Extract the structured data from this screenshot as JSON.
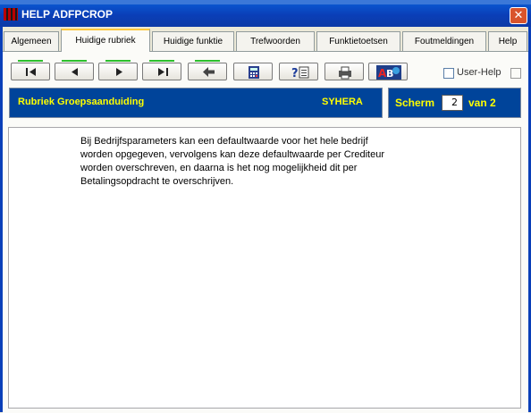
{
  "window": {
    "title": "HELP ADFPCROP",
    "close_glyph": "✕"
  },
  "tabs": [
    {
      "label": "Algemeen",
      "active": false
    },
    {
      "label": "Huidige rubriek",
      "active": true
    },
    {
      "label": "Huidige funktie",
      "active": false
    },
    {
      "label": "Trefwoorden",
      "active": false
    },
    {
      "label": "Funktietoetsen",
      "active": false
    },
    {
      "label": "Foutmeldingen",
      "active": false
    },
    {
      "label": "Help",
      "active": false
    }
  ],
  "toolbar": {
    "buttons": [
      "first-page-icon",
      "previous-page-icon",
      "next-page-icon",
      "last-page-icon",
      "back-arrow-icon",
      "calculator-icon",
      "question-help-icon",
      "printer-icon",
      "abc-tools-icon"
    ],
    "user_help_label": "User-Help"
  },
  "rubriek": {
    "label": "Rubriek Groepsaanduiding",
    "code": "SYHERA"
  },
  "scherm": {
    "label": "Scherm",
    "current": "2",
    "van_label": "van 2"
  },
  "content": {
    "text": "Bij Bedrijfsparameters kan een defaultwaarde voor het hele bedrijf\nworden opgegeven, vervolgens kan deze defaultwaarde per Crediteur\nworden overschreven, en daarna is het nog mogelijkheid dit per\nBetalingsopdracht te overschrijven."
  },
  "colors": {
    "info_bar": "#00449a",
    "info_text": "#ffff00",
    "title_bar": "#0a3fb8",
    "close": "#d9542c"
  }
}
